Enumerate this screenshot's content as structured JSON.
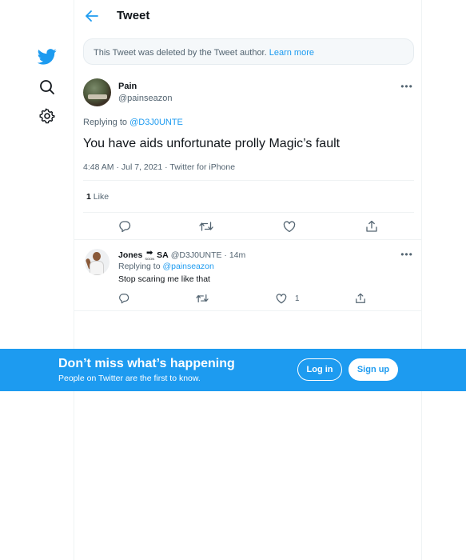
{
  "colors": {
    "accent": "#1d9bf0",
    "text": "#0f1419",
    "muted": "#536471",
    "border": "#eff3f4"
  },
  "nav": {
    "items": [
      {
        "icon": "twitter-bird-icon"
      },
      {
        "icon": "search-icon"
      },
      {
        "icon": "gear-icon"
      }
    ]
  },
  "header": {
    "title": "Tweet",
    "back_icon": "arrow-left-icon"
  },
  "deleted_notice": {
    "text": "This Tweet was deleted by the Tweet author.",
    "link": "Learn more"
  },
  "tweet": {
    "display_name": "Pain",
    "handle": "@painseazon",
    "replying_prefix": "Replying to",
    "replying_to": "@D3J0UNTE",
    "text": "You have aids unfortunate prolly Magic’s fault",
    "meta": "4:48 AM · Jul 7, 2021 · Twitter for iPhone",
    "likes_count": "1",
    "likes_label": "Like",
    "actions": [
      "reply-icon",
      "retweet-icon",
      "like-icon",
      "share-icon"
    ]
  },
  "reply": {
    "name_part1": "Jones",
    "soon_arrow": "➡",
    "soon_tag": "SOON",
    "name_part2": "SA",
    "handle_time": "@D3J0UNTE · 14m",
    "replying_prefix": "Replying to",
    "replying_to": "@painseazon",
    "text": "Stop scaring me like that",
    "like_count": "1"
  },
  "banner": {
    "title": "Don’t miss what’s happening",
    "subtitle": "People on Twitter are the first to know.",
    "login_label": "Log in",
    "signup_label": "Sign up"
  }
}
